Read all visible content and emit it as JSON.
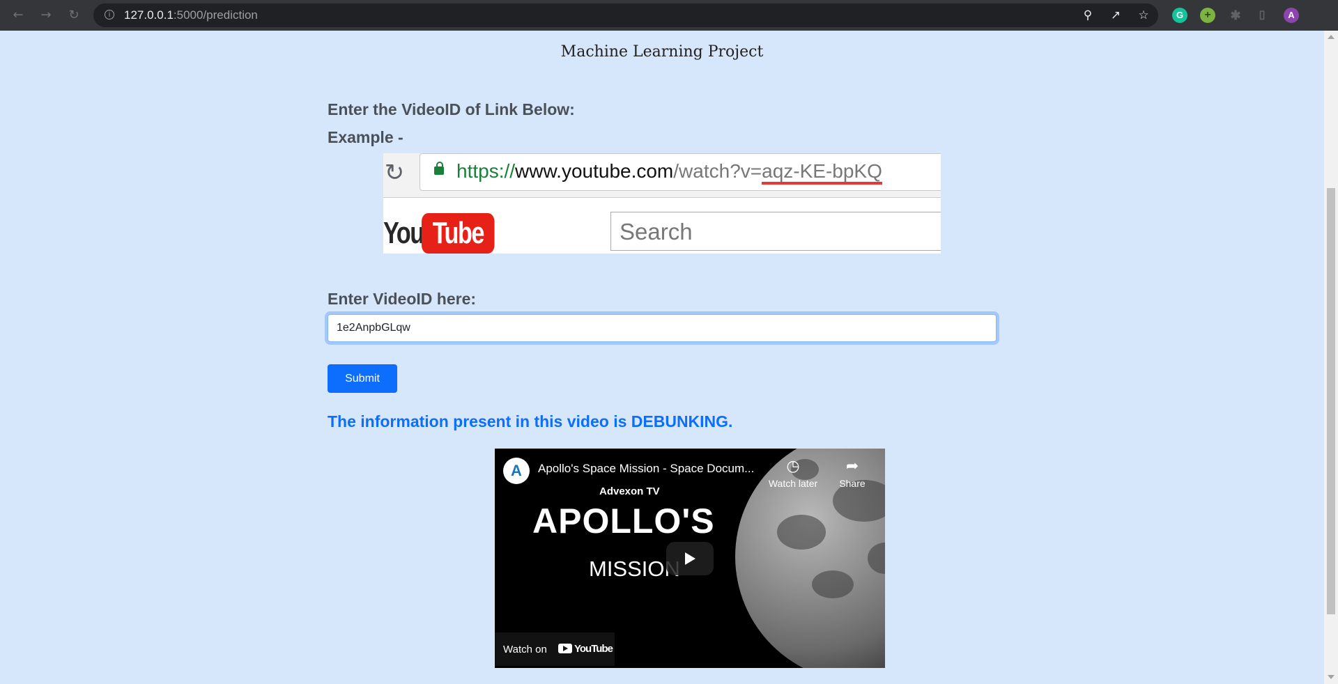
{
  "browser": {
    "url_host": "127.0.0.1",
    "url_path": ":5000/prediction",
    "profile_initial": "A",
    "ext_grammarly": "G"
  },
  "page": {
    "title": "Machine Learning Project",
    "instruction_label": "Enter the VideoID of Link Below:",
    "example_label": "Example -",
    "example_image": {
      "url_scheme": "https://",
      "url_domain": "www.youtube.com",
      "url_path": "/watch?v=",
      "url_video_id": "aqz-KE-bpKQ",
      "logo_you": "You",
      "logo_tube": "Tube",
      "search_placeholder": "Search"
    },
    "input_label": "Enter VideoID here:",
    "video_id_value": "1e2AnpbGLqw",
    "submit_label": "Submit",
    "result_text": "The information present in this video is DEBUNKING."
  },
  "video": {
    "title": "Apollo's Space Mission - Space Docum...",
    "channel_initial": "A",
    "watch_later_label": "Watch later",
    "share_label": "Share",
    "brand_text": "Advexon TV",
    "headline": "APOLLO'S",
    "subheadline": "MISSION",
    "watch_on_label": "Watch on",
    "youtube_label": "YouTube"
  },
  "colors": {
    "page_bg": "#d6e6fb",
    "primary": "#0d6efd",
    "label_text": "#4a5058"
  }
}
